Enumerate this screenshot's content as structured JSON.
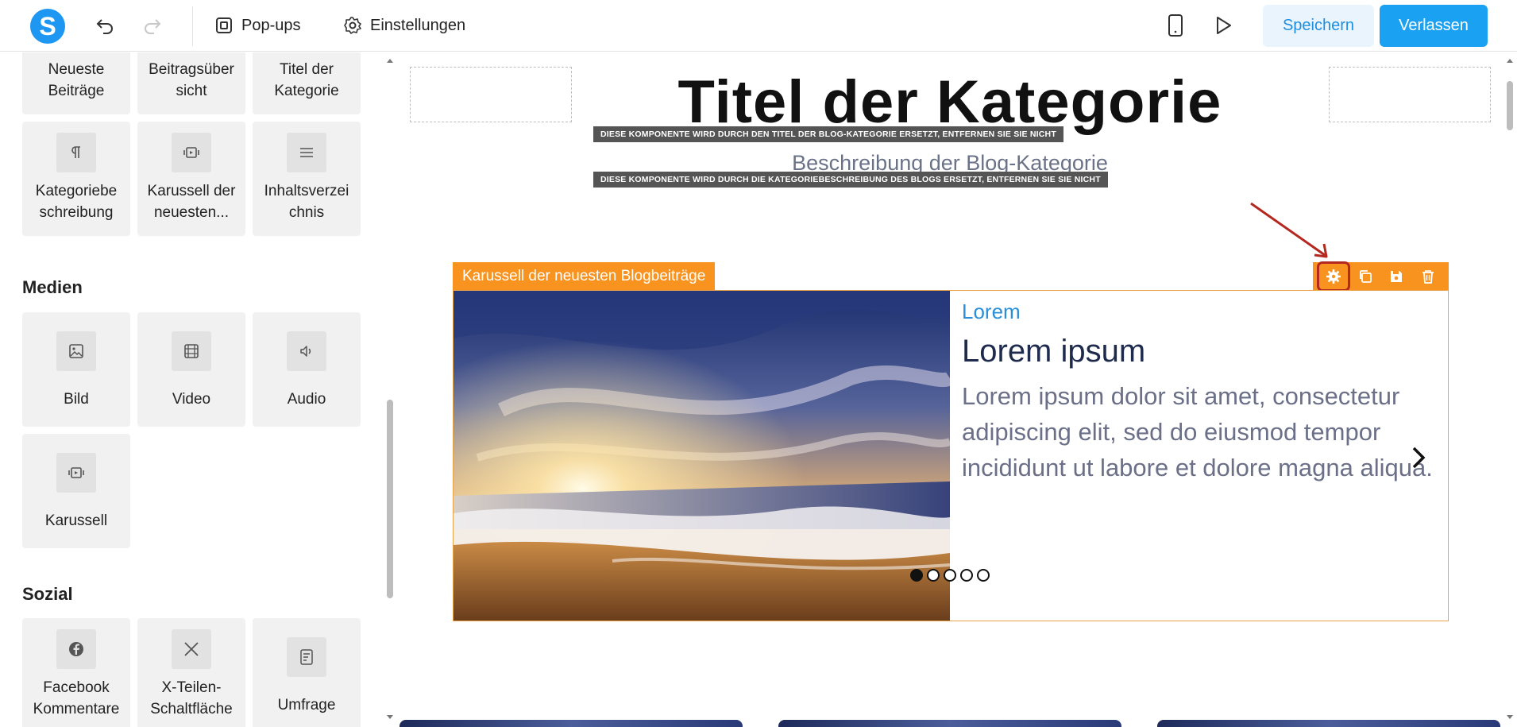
{
  "topbar": {
    "logo_letter": "S",
    "popups_label": "Pop-ups",
    "settings_label": "Einstellungen",
    "save_label": "Speichern",
    "exit_label": "Verlassen"
  },
  "sidebar": {
    "blog_items": [
      {
        "label": "Neueste Beiträge"
      },
      {
        "label": "Beitragsüber sicht"
      },
      {
        "label": "Titel der Kategorie"
      },
      {
        "label": "Kategoriebe schreibung"
      },
      {
        "label": "Karussell der neuesten..."
      },
      {
        "label": "Inhaltsverzei chnis"
      }
    ],
    "media_title": "Medien",
    "media_items": [
      {
        "label": "Bild"
      },
      {
        "label": "Video"
      },
      {
        "label": "Audio"
      },
      {
        "label": "Karussell"
      }
    ],
    "social_title": "Sozial",
    "social_items": [
      {
        "label": "Facebook Kommentare"
      },
      {
        "label": "X-Teilen-Schaltfläche"
      },
      {
        "label": "Umfrage"
      }
    ]
  },
  "canvas": {
    "category_title": "Titel der Kategorie",
    "title_warning": "DIESE KOMPONENTE WIRD DURCH DEN TITEL DER BLOG-KATEGORIE ERSETZT, ENTFERNEN SIE SIE NICHT",
    "category_description": "Beschreibung der Blog-Kategorie",
    "description_warning": "DIESE KOMPONENTE WIRD DURCH DIE KATEGORIEBESCHREIBUNG DES BLOGS ERSETZT, ENTFERNEN SIE SIE NICHT",
    "carousel": {
      "tag": "Karussell der neuesten Blogbeiträge",
      "category": "Lorem",
      "title": "Lorem ipsum",
      "text": "Lorem ipsum dolor sit amet, consectetur adipiscing elit, sed do eiusmod tempor incididunt ut labore et dolore magna aliqua.",
      "slide_count": 5,
      "active_slide": 1
    }
  },
  "colors": {
    "primary": "#1ba1f2",
    "accent_orange": "#f7931e",
    "highlight_red": "#b5281f"
  }
}
